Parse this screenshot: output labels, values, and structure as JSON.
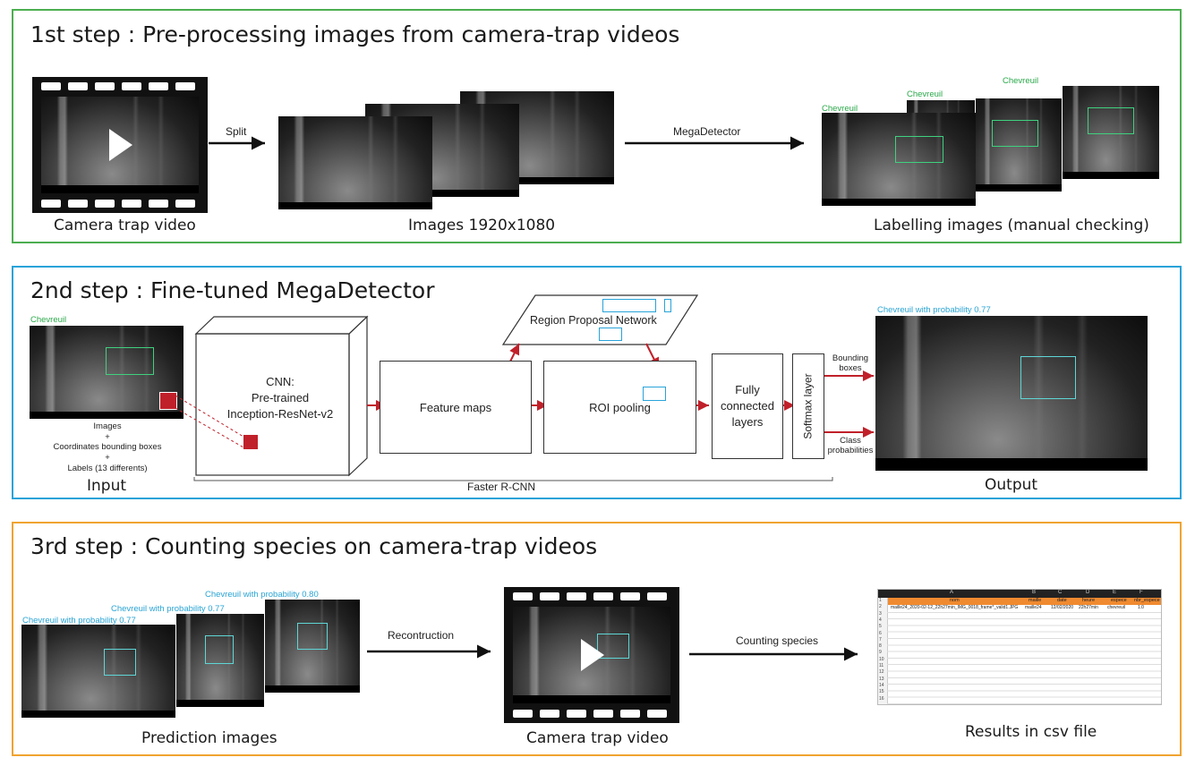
{
  "step1": {
    "title": "1st step : Pre-processing images from camera-trap videos",
    "border_color": "#4caf50",
    "split_label": "Split",
    "megadetector_label": "MegaDetector",
    "caption_video": "Camera trap video",
    "caption_images": "Images 1920x1080",
    "caption_labelling": "Labelling images (manual checking)",
    "species_label": "Chevreuil"
  },
  "step2": {
    "title": "2nd step : Fine-tuned MegaDetector",
    "border_color": "#29a3d9",
    "input_species": "Chevreuil",
    "input_text": [
      "Images",
      "+",
      "Coordinates bounding boxes",
      "+",
      "Labels (13 differents)"
    ],
    "caption_input": "Input",
    "cnn_label": "CNN:\nPre-trained\nInception-ResNet-v2",
    "rpn_label": "Region Proposal Network",
    "feature_maps": "Feature maps",
    "roi_pooling": "ROI pooling",
    "fc_layers": "Fully\nconnected\nlayers",
    "softmax": "Softmax layer",
    "bounding_boxes": "Bounding\nboxes",
    "class_probabilities": "Class\nprobabilities",
    "faster_rcnn": "Faster R-CNN",
    "output_label": "Chevreuil with probability 0.77",
    "caption_output": "Output",
    "accent_red": "#c0202a"
  },
  "step3": {
    "title": "3rd step : Counting species on camera-trap videos",
    "border_color": "#f0a330",
    "pred_labels": [
      "Chevreuil with probability 0.77",
      "Chevreuil with probability 0.77",
      "Chevreuil with probability 0.80"
    ],
    "reconstruction_label": "Recontruction",
    "counting_label": "Counting species",
    "caption_pred": "Prediction images",
    "caption_video": "Camera trap video",
    "caption_results": "Results in csv file",
    "csv": {
      "columns": [
        "A",
        "B",
        "C",
        "D",
        "E",
        "F"
      ],
      "header": [
        "nom",
        "maille",
        "date",
        "heure",
        "espece",
        "nbr_espece"
      ],
      "row": [
        "maille24_2020-02-12_22h27min_IMG_0018_frame*_valid1.JPG",
        "maille24",
        "12/02/2020",
        "22h27min",
        "chevreuil",
        "1.0"
      ],
      "row_numbers": [
        "1",
        "2",
        "3",
        "4",
        "5",
        "6",
        "7",
        "8",
        "9",
        "10",
        "11",
        "12",
        "13",
        "14",
        "15",
        "16"
      ]
    }
  }
}
